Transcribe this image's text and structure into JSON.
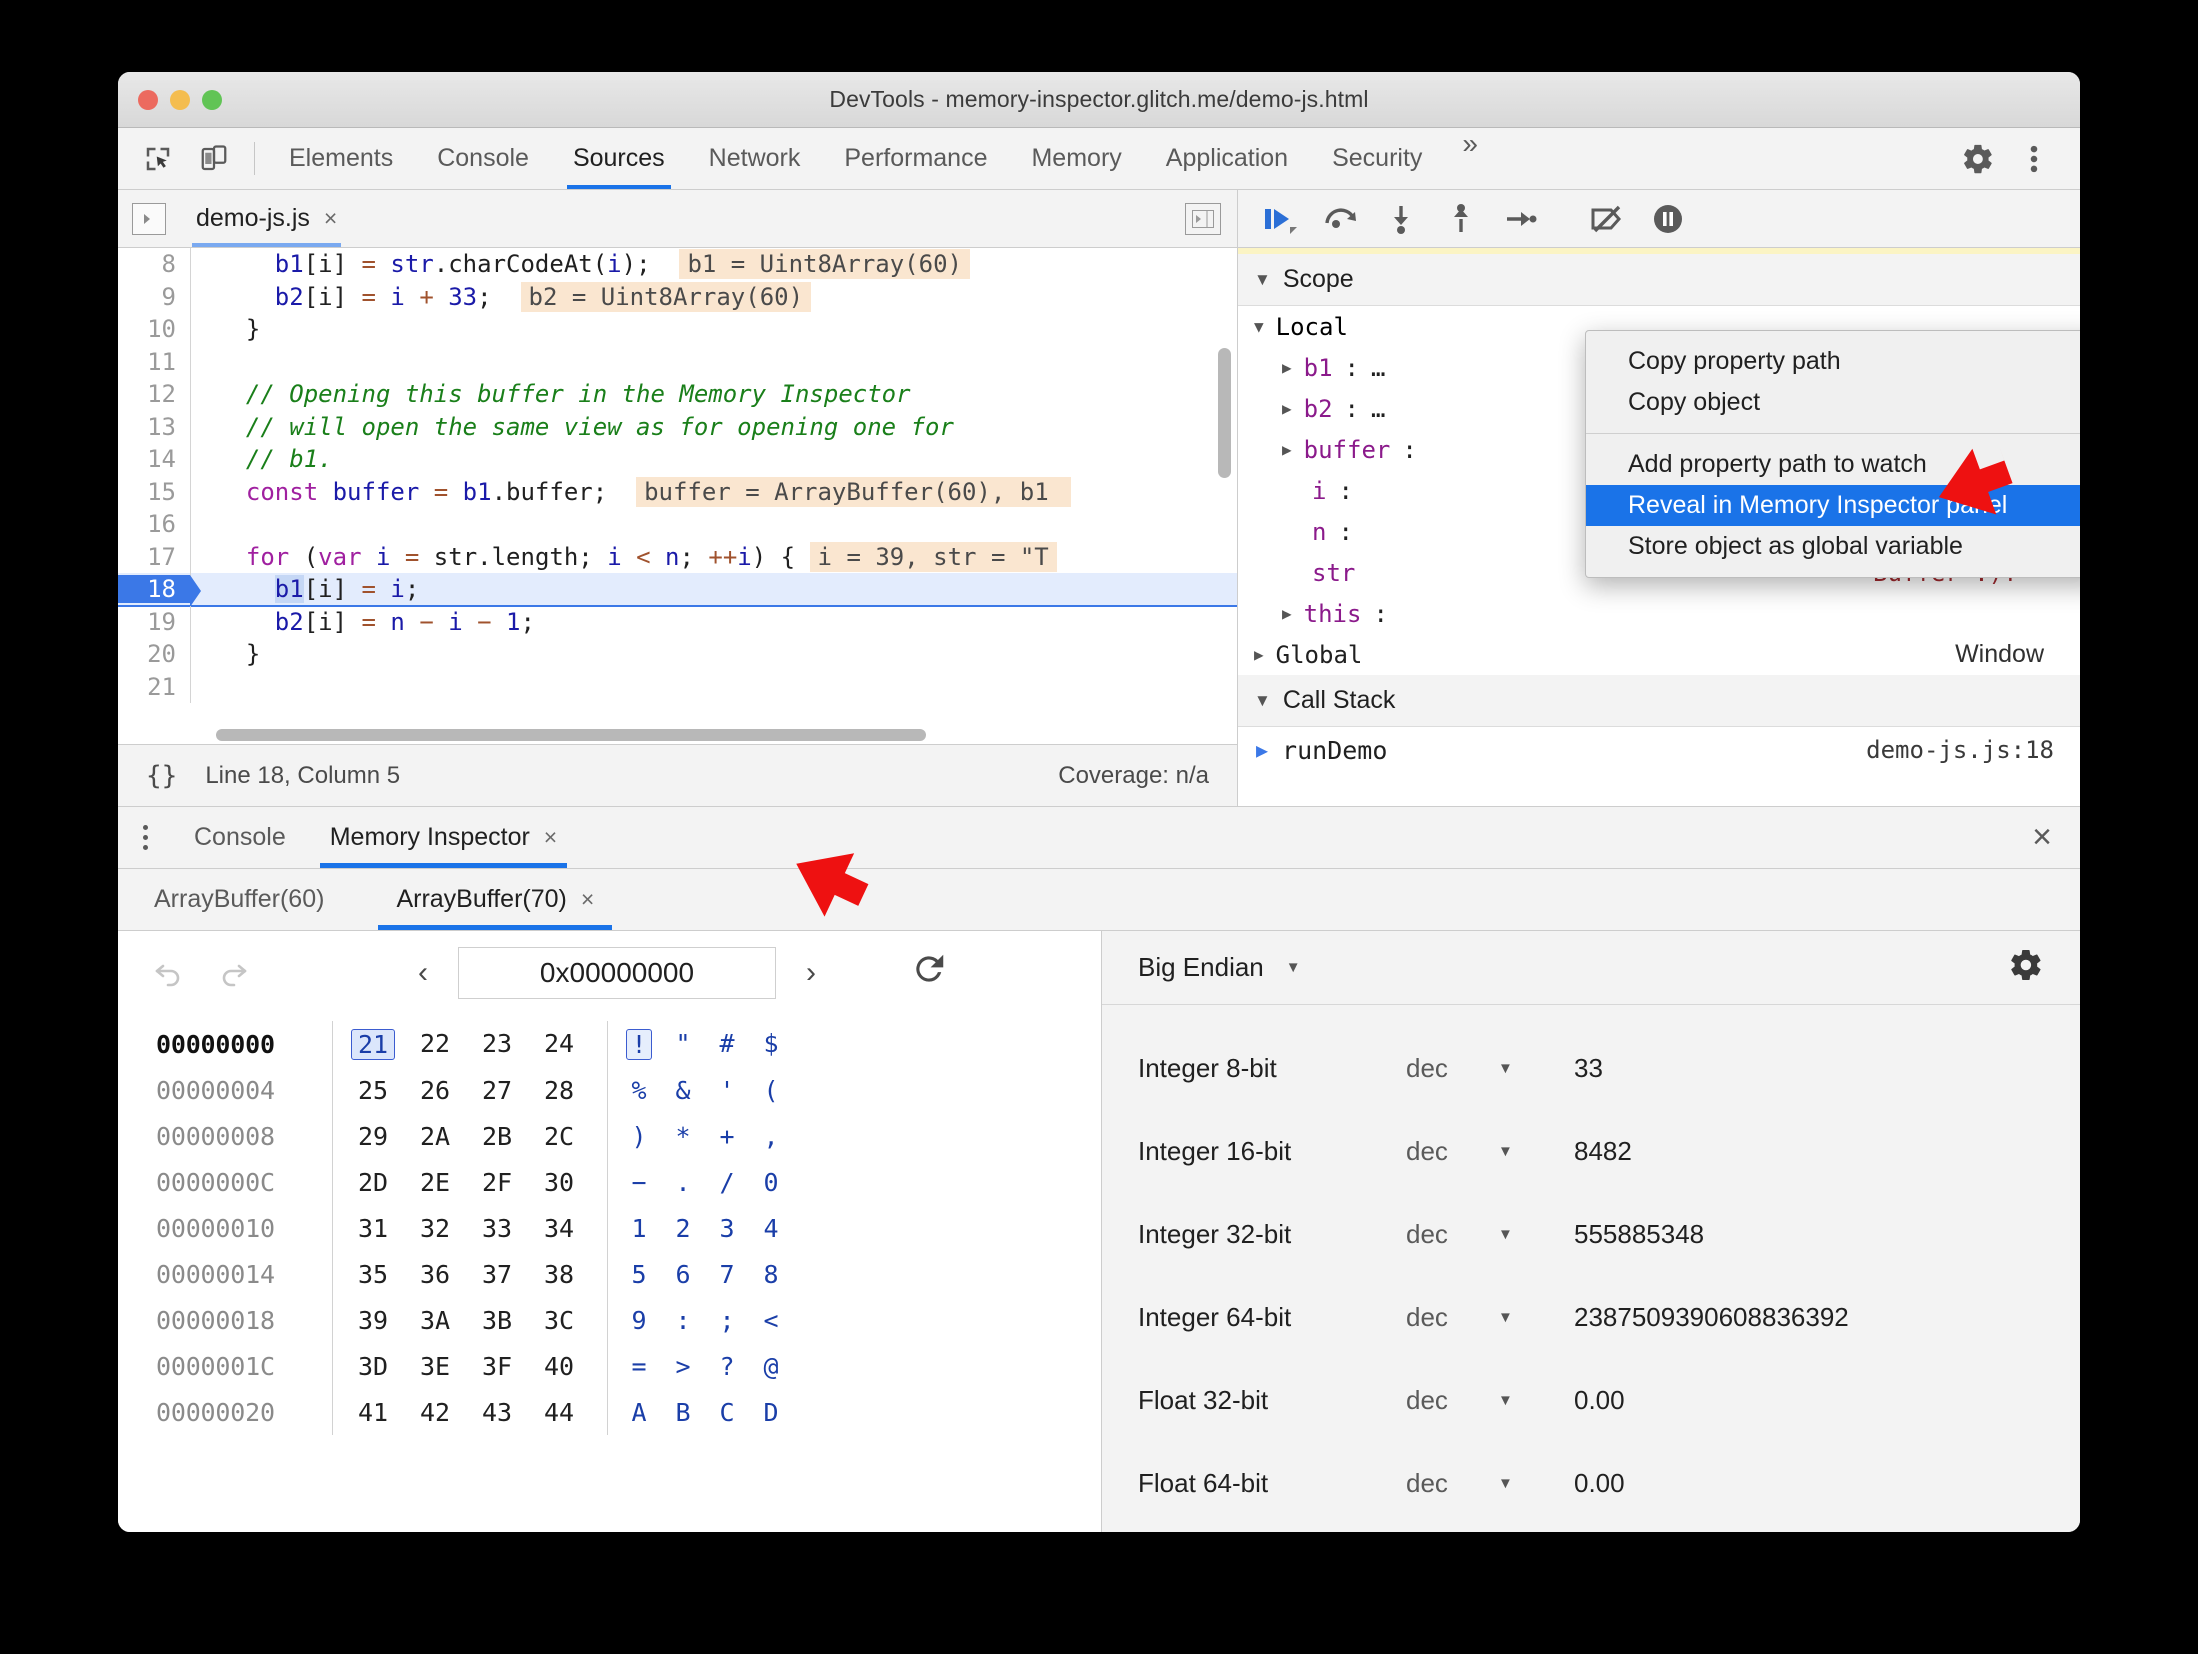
{
  "window": {
    "title": "DevTools - memory-inspector.glitch.me/demo-js.html",
    "traffic": {
      "close": "close-window",
      "minimize": "minimize-window",
      "zoom": "zoom-window"
    }
  },
  "main_tabs": {
    "items": [
      {
        "label": "Elements",
        "active": false
      },
      {
        "label": "Console",
        "active": false
      },
      {
        "label": "Sources",
        "active": true
      },
      {
        "label": "Network",
        "active": false
      },
      {
        "label": "Performance",
        "active": false
      },
      {
        "label": "Memory",
        "active": false
      },
      {
        "label": "Application",
        "active": false
      },
      {
        "label": "Security",
        "active": false
      }
    ],
    "overflow": "»",
    "settings_icon": "gear-icon",
    "more_icon": "vertical-dots-icon"
  },
  "editor": {
    "file_tab": {
      "label": "demo-js.js",
      "close": "×"
    },
    "lines": [
      {
        "num": "8",
        "current": false
      },
      {
        "num": "9",
        "current": false
      },
      {
        "num": "10",
        "current": false
      },
      {
        "num": "11",
        "current": false
      },
      {
        "num": "12",
        "current": false
      },
      {
        "num": "13",
        "current": false
      },
      {
        "num": "14",
        "current": false
      },
      {
        "num": "15",
        "current": false
      },
      {
        "num": "16",
        "current": false
      },
      {
        "num": "17",
        "current": false
      },
      {
        "num": "18",
        "current": true
      },
      {
        "num": "19",
        "current": false
      },
      {
        "num": "20",
        "current": false
      },
      {
        "num": "21",
        "current": false
      }
    ],
    "code": {
      "l8_b1": "b1",
      "l8_idx": "[i]",
      "l8_eq": "=",
      "l8_str": "str",
      "l8_rest": ".charCodeAt(",
      "l8_i": "i",
      "l8_tail": ");",
      "l8_chip": "b1 = Uint8Array(60)",
      "l9_b2": "b2",
      "l9_idx": "[i]",
      "l9_eq": "=",
      "l9_i": "i",
      "l9_plus": "+",
      "l9_num": "33",
      "l9_semi": ";",
      "l9_chip": "b2 = Uint8Array(60)",
      "l10": "}",
      "l12": "// Opening this buffer in the Memory Inspector",
      "l13": "// will open the same view as for opening one for",
      "l14": "// b1.",
      "l15_const": "const",
      "l15_buffer": "buffer",
      "l15_eq": "=",
      "l15_b1": "b1",
      "l15_tail": ".buffer;",
      "l15_chip": "buffer = ArrayBuffer(60), b1 ",
      "l17_for": "for",
      "l17_p1": "(",
      "l17_var": "var",
      "l17_i": "i",
      "l17_eq": "=",
      "l17_str": "str",
      "l17_len": ".length;",
      "l17_i2": "i",
      "l17_lt": "<",
      "l17_n": "n",
      "l17_semi": ";",
      "l17_inc": "++",
      "l17_i3": "i",
      "l17_tail": ") {",
      "l17_chip": "i = 39, str = \"T",
      "l18_b1": "b1",
      "l18_idx": "[i]",
      "l18_eq": "=",
      "l18_i": "i",
      "l18_semi": ";",
      "l19_b2": "b2",
      "l19_idx": "[i]",
      "l19_eq": "=",
      "l19_n": "n",
      "l19_minus": "−",
      "l19_i": "i",
      "l19_minus2": "−",
      "l19_one": "1",
      "l19_semi": ";",
      "l20": "}"
    },
    "status": {
      "pretty_print": "{}",
      "position": "Line 18, Column 5",
      "coverage": "Coverage: n/a"
    }
  },
  "debugger": {
    "buttons": [
      {
        "name": "resume-script-button"
      },
      {
        "name": "step-over-button"
      },
      {
        "name": "step-into-button"
      },
      {
        "name": "step-out-button"
      },
      {
        "name": "step-button"
      },
      {
        "name": "deactivate-breakpoints-button"
      },
      {
        "name": "pause-on-exceptions-button"
      }
    ],
    "scope": {
      "title": "Scope",
      "local_title": "Local",
      "rows": [
        {
          "name": "b1",
          "sep": ":",
          "value": "…",
          "expandable": true
        },
        {
          "name": "b2",
          "sep": ":",
          "value": "…",
          "expandable": true
        },
        {
          "name": "buffer",
          "sep": ":",
          "value": "",
          "expandable": true
        },
        {
          "name": "i",
          "sep": ":",
          "value": "",
          "expandable": false
        },
        {
          "name": "n",
          "sep": ":",
          "value": "",
          "expandable": false
        },
        {
          "name": "str",
          "sep": "",
          "value": "Buffer :)!\"",
          "expandable": false
        },
        {
          "name": "this",
          "sep": ":",
          "value": "",
          "expandable": true
        }
      ],
      "global_label": "Global",
      "global_value": "Window"
    },
    "call_stack": {
      "title": "Call Stack",
      "rows": [
        {
          "fn": "runDemo",
          "location": "demo-js.js:18"
        }
      ]
    }
  },
  "context_menu": {
    "items": [
      {
        "label": "Copy property path",
        "selected": false,
        "separator_after": false
      },
      {
        "label": "Copy object",
        "selected": false,
        "separator_after": true
      },
      {
        "label": "Add property path to watch",
        "selected": false,
        "separator_after": false
      },
      {
        "label": "Reveal in Memory Inspector panel",
        "selected": true,
        "separator_after": false
      },
      {
        "label": "Store object as global variable",
        "selected": false,
        "separator_after": false
      }
    ],
    "highlight_color": "#1a73e8"
  },
  "drawer": {
    "tabs": [
      {
        "label": "Console",
        "active": false,
        "closable": false
      },
      {
        "label": "Memory Inspector",
        "active": true,
        "closable": true,
        "close": "×"
      }
    ],
    "close_drawer": "×",
    "memory_tabs": [
      {
        "label": "ArrayBuffer(60)",
        "active": false,
        "closable": false
      },
      {
        "label": "ArrayBuffer(70)",
        "active": true,
        "closable": true,
        "close": "×"
      }
    ]
  },
  "memory_inspector": {
    "toolbar": {
      "undo_icon": "undo-icon",
      "redo_icon": "redo-icon",
      "prev_icon": "‹",
      "next_icon": "›",
      "address": "0x00000000",
      "address_placeholder": "0x00000000",
      "refresh_icon": "refresh-icon"
    },
    "hex_rows": [
      {
        "address": "00000000",
        "bytes": [
          "21",
          "22",
          "23",
          "24"
        ],
        "ascii": [
          "!",
          "\"",
          "#",
          "$"
        ],
        "selected_index": 0
      },
      {
        "address": "00000004",
        "bytes": [
          "25",
          "26",
          "27",
          "28"
        ],
        "ascii": [
          "%",
          "&",
          "'",
          "("
        ],
        "selected_index": -1
      },
      {
        "address": "00000008",
        "bytes": [
          "29",
          "2A",
          "2B",
          "2C"
        ],
        "ascii": [
          ")",
          "*",
          "+",
          ","
        ],
        "selected_index": -1
      },
      {
        "address": "0000000C",
        "bytes": [
          "2D",
          "2E",
          "2F",
          "30"
        ],
        "ascii": [
          "−",
          ".",
          "/",
          "0"
        ],
        "selected_index": -1
      },
      {
        "address": "00000010",
        "bytes": [
          "31",
          "32",
          "33",
          "34"
        ],
        "ascii": [
          "1",
          "2",
          "3",
          "4"
        ],
        "selected_index": -1
      },
      {
        "address": "00000014",
        "bytes": [
          "35",
          "36",
          "37",
          "38"
        ],
        "ascii": [
          "5",
          "6",
          "7",
          "8"
        ],
        "selected_index": -1
      },
      {
        "address": "00000018",
        "bytes": [
          "39",
          "3A",
          "3B",
          "3C"
        ],
        "ascii": [
          "9",
          ":",
          ";",
          "<"
        ],
        "selected_index": -1
      },
      {
        "address": "0000001C",
        "bytes": [
          "3D",
          "3E",
          "3F",
          "40"
        ],
        "ascii": [
          "=",
          ">",
          "?",
          "@"
        ],
        "selected_index": -1
      },
      {
        "address": "00000020",
        "bytes": [
          "41",
          "42",
          "43",
          "44"
        ],
        "ascii": [
          "A",
          "B",
          "C",
          "D"
        ],
        "selected_index": -1
      }
    ],
    "value_inspector": {
      "endianness": "Big Endian",
      "settings_icon": "gear-icon",
      "rows": [
        {
          "type": "Integer 8-bit",
          "mode": "dec",
          "value": "33"
        },
        {
          "type": "Integer 16-bit",
          "mode": "dec",
          "value": "8482"
        },
        {
          "type": "Integer 32-bit",
          "mode": "dec",
          "value": "555885348"
        },
        {
          "type": "Integer 64-bit",
          "mode": "dec",
          "value": "2387509390608836392"
        },
        {
          "type": "Float 32-bit",
          "mode": "dec",
          "value": "0.00"
        },
        {
          "type": "Float 64-bit",
          "mode": "dec",
          "value": "0.00"
        }
      ]
    }
  },
  "annotations": {
    "arrow_color": "#ee1111",
    "arrows": [
      {
        "name": "arrow-pointing-to-context-menu-item"
      },
      {
        "name": "arrow-pointing-to-memory-inspector-tab"
      }
    ]
  }
}
